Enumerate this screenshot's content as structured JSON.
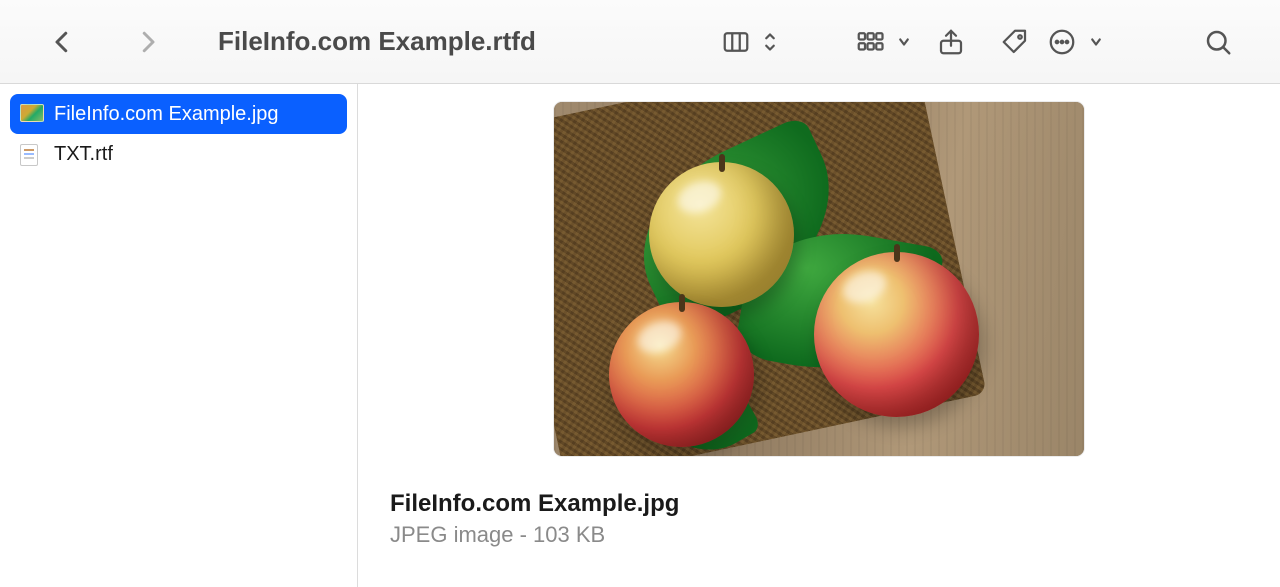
{
  "toolbar": {
    "title": "FileInfo.com Example.rtfd"
  },
  "sidebar": {
    "items": [
      {
        "name": "FileInfo.com Example.jpg",
        "type": "jpg",
        "selected": true
      },
      {
        "name": "TXT.rtf",
        "type": "rtf",
        "selected": false
      }
    ]
  },
  "preview": {
    "filename": "FileInfo.com Example.jpg",
    "details": "JPEG image - 103 KB"
  }
}
